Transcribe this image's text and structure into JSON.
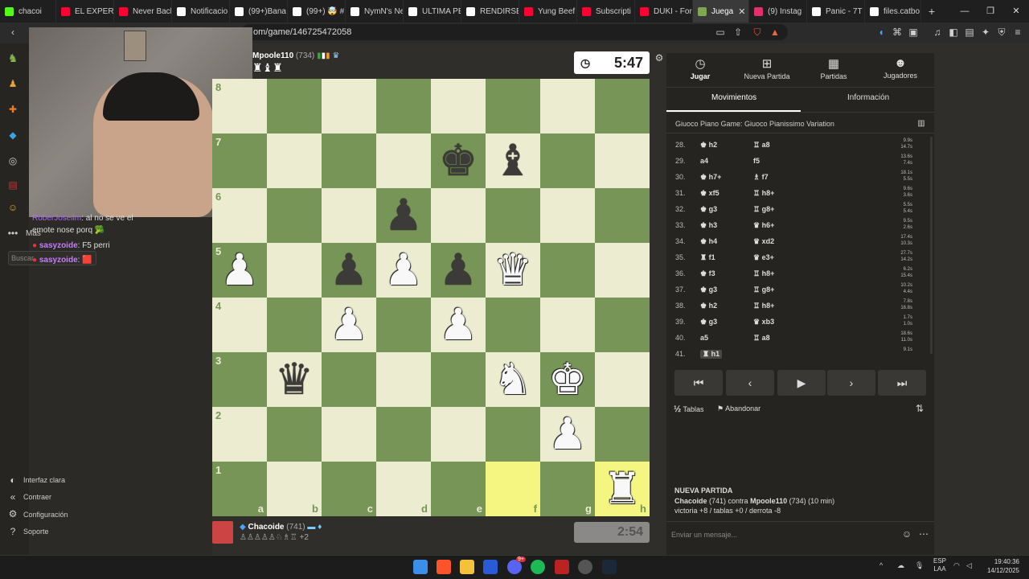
{
  "tabs": [
    {
      "label": "chacoi",
      "color": "#53fc18"
    },
    {
      "label": "EL EXPERIM",
      "color": "#ff0033"
    },
    {
      "label": "Never Back",
      "color": "#ff0033"
    },
    {
      "label": "Notificacio",
      "color": "#ffffff"
    },
    {
      "label": "(99+)Bana",
      "color": "#ffffff"
    },
    {
      "label": "(99+) 🤯 #",
      "color": "#ffffff"
    },
    {
      "label": "NymN's Ne",
      "color": "#ffffff"
    },
    {
      "label": "ULTIMA PE",
      "color": "#ffffff"
    },
    {
      "label": "RENDIRSE",
      "color": "#ffffff"
    },
    {
      "label": "Yung Beef",
      "color": "#ff0033"
    },
    {
      "label": "Subscripti",
      "color": "#ff0033"
    },
    {
      "label": "DUKI - For",
      "color": "#ff0033"
    },
    {
      "label": "Juega",
      "color": "#7fa650",
      "active": true
    },
    {
      "label": "(9) Instag",
      "color": "#e1306c"
    },
    {
      "label": "Panic - 7T",
      "color": "#ffffff"
    },
    {
      "label": "files.catbo",
      "color": "#ffffff"
    }
  ],
  "url": "om/game/146725472058",
  "sidebar": {
    "more_label": "Más",
    "search_placeholder": "Buscar",
    "light_ui": "Interfaz clara",
    "collapse": "Contraer",
    "settings": "Configuración",
    "support": "Soporte"
  },
  "chat": [
    {
      "user": "RoberJoseilm",
      "text": ": al no se ve el"
    },
    {
      "user": "",
      "text": "emote nose porq 🥦"
    },
    {
      "user": "sasyzoide",
      "text": ": F5 perri"
    },
    {
      "user": "sasyzoide",
      "text": ": 🟥"
    }
  ],
  "top_player": {
    "name": "Mpoole110",
    "rating": "(734)",
    "clock": "5:47"
  },
  "bottom_player": {
    "name": "Chacoide",
    "rating": "(741)",
    "captured_extra": "+2",
    "clock": "2:54"
  },
  "board": [
    [
      "",
      "",
      "",
      "",
      "",
      "",
      "",
      ""
    ],
    [
      "",
      "",
      "",
      "",
      "bk",
      "bb",
      "",
      ""
    ],
    [
      "",
      "",
      "",
      "bp",
      "",
      "",
      "",
      ""
    ],
    [
      "wp",
      "",
      "bp",
      "wp",
      "bp",
      "wq",
      "",
      ""
    ],
    [
      "",
      "",
      "wp",
      "",
      "wp",
      "",
      "",
      ""
    ],
    [
      "",
      "bq",
      "",
      "",
      "",
      "wn",
      "wk",
      ""
    ],
    [
      "",
      "",
      "",
      "",
      "",
      "",
      "wp",
      ""
    ],
    [
      "",
      "",
      "",
      "",
      "",
      "",
      "",
      "wr"
    ]
  ],
  "rank_labels": [
    "8",
    "7",
    "6",
    "5",
    "4",
    "3",
    "2",
    "1"
  ],
  "file_labels": [
    "a",
    "b",
    "c",
    "d",
    "e",
    "f",
    "g",
    "h"
  ],
  "right_panel": {
    "tabs": [
      "Jugar",
      "Nueva Partida",
      "Partidas",
      "Jugadores"
    ],
    "subtabs": [
      "Movimientos",
      "Información"
    ],
    "opening": "Giuoco Piano Game: Giuoco Pianissimo Variation",
    "moves": [
      {
        "n": "28.",
        "w": "♚ h2",
        "b": "♖ a8",
        "t1": "9.9s",
        "t2": "14.7s"
      },
      {
        "n": "29.",
        "w": "a4",
        "b": "f5",
        "t1": "13.6s",
        "t2": "7.4s"
      },
      {
        "n": "30.",
        "w": "♚ h7+",
        "b": "♗ f7",
        "t1": "18.1s",
        "t2": "5.5s"
      },
      {
        "n": "31.",
        "w": "♚ xf5",
        "b": "♖ h8+",
        "t1": "9.6s",
        "t2": "3.6s"
      },
      {
        "n": "32.",
        "w": "♚ g3",
        "b": "♖ g8+",
        "t1": "5.5s",
        "t2": "5.4s"
      },
      {
        "n": "33.",
        "w": "♚ h3",
        "b": "♛ h6+",
        "t1": "9.5s",
        "t2": "2.6s"
      },
      {
        "n": "34.",
        "w": "♚ h4",
        "b": "♛ xd2",
        "t1": "17.4s",
        "t2": "10.3s"
      },
      {
        "n": "35.",
        "w": "♜ f1",
        "b": "♛ e3+",
        "t1": "27.7s",
        "t2": "14.2s"
      },
      {
        "n": "36.",
        "w": "♚ f3",
        "b": "♖ h8+",
        "t1": "6.2s",
        "t2": "15.4s"
      },
      {
        "n": "37.",
        "w": "♚ g3",
        "b": "♖ g8+",
        "t1": "10.2s",
        "t2": "4.4s"
      },
      {
        "n": "38.",
        "w": "♚ h2",
        "b": "♖ h8+",
        "t1": "7.8s",
        "t2": "16.8s"
      },
      {
        "n": "39.",
        "w": "♚ g3",
        "b": "♛ xb3",
        "t1": "1.7s",
        "t2": "1.0s"
      },
      {
        "n": "40.",
        "w": "a5",
        "b": "♖ a8",
        "t1": "18.6s",
        "t2": "11.0s"
      },
      {
        "n": "41.",
        "w": "♜ h1",
        "b": "",
        "t1": "9.1s",
        "t2": ""
      }
    ],
    "draw": "Tablas",
    "resign": "Abandonar",
    "new_game_title": "NUEVA PARTIDA",
    "new_game_p1": "Chacoide",
    "new_game_p1_rating": "(741) contra",
    "new_game_p2": "Mpoole110",
    "new_game_p2_rating": "(734) (10 min)",
    "new_game_stats": "victoria +8 / tablas +0 / derrota -8",
    "message_placeholder": "Enviar un mensaje..."
  },
  "taskbar": {
    "lang1": "ESP",
    "lang2": "LAA",
    "time": "19:40:36",
    "date": "14/12/2025",
    "badge": "9+"
  }
}
